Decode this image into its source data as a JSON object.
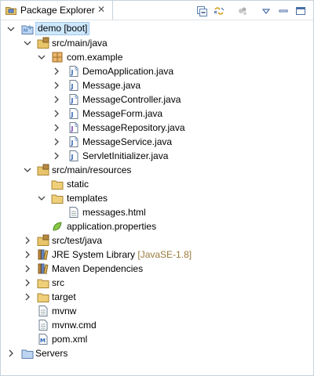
{
  "tab": {
    "title": "Package Explorer",
    "close": "✕"
  },
  "toolbar": [
    "collapse-all-icon",
    "link-with-editor-icon",
    "focus-icon",
    "view-menu-icon",
    "minimize-icon",
    "maximize-icon"
  ],
  "tree": [
    {
      "label": "demo [boot]",
      "icon": "boot-project-icon",
      "expanded": true,
      "selected": true
    },
    {
      "label": "src/main/java",
      "icon": "source-folder-icon",
      "expanded": true
    },
    {
      "label": "com.example",
      "icon": "package-icon",
      "expanded": true
    },
    {
      "label": "DemoApplication.java",
      "icon": "java-file-icon"
    },
    {
      "label": "Message.java",
      "icon": "java-file-icon"
    },
    {
      "label": "MessageController.java",
      "icon": "java-file-icon"
    },
    {
      "label": "MessageForm.java",
      "icon": "java-file-icon"
    },
    {
      "label": "MessageRepository.java",
      "icon": "java-file-icon"
    },
    {
      "label": "MessageService.java",
      "icon": "java-file-icon"
    },
    {
      "label": "ServletInitializer.java",
      "icon": "java-file-icon"
    },
    {
      "label": "src/main/resources",
      "icon": "source-folder-icon",
      "expanded": true
    },
    {
      "label": "static",
      "icon": "folder-icon"
    },
    {
      "label": "templates",
      "icon": "folder-icon",
      "expanded": true
    },
    {
      "label": "messages.html",
      "icon": "file-icon"
    },
    {
      "label": "application.properties",
      "icon": "properties-icon"
    },
    {
      "label": "src/test/java",
      "icon": "source-folder-icon"
    },
    {
      "label": "JRE System Library",
      "decoration": "[JavaSE-1.8]",
      "icon": "library-icon"
    },
    {
      "label": "Maven Dependencies",
      "icon": "library-icon"
    },
    {
      "label": "src",
      "icon": "folder-icon"
    },
    {
      "label": "target",
      "icon": "folder-icon"
    },
    {
      "label": "mvnw",
      "icon": "file-icon"
    },
    {
      "label": "mvnw.cmd",
      "icon": "file-icon"
    },
    {
      "label": "pom.xml",
      "icon": "maven-pom-icon"
    },
    {
      "label": "Servers",
      "icon": "servers-folder-icon"
    }
  ]
}
